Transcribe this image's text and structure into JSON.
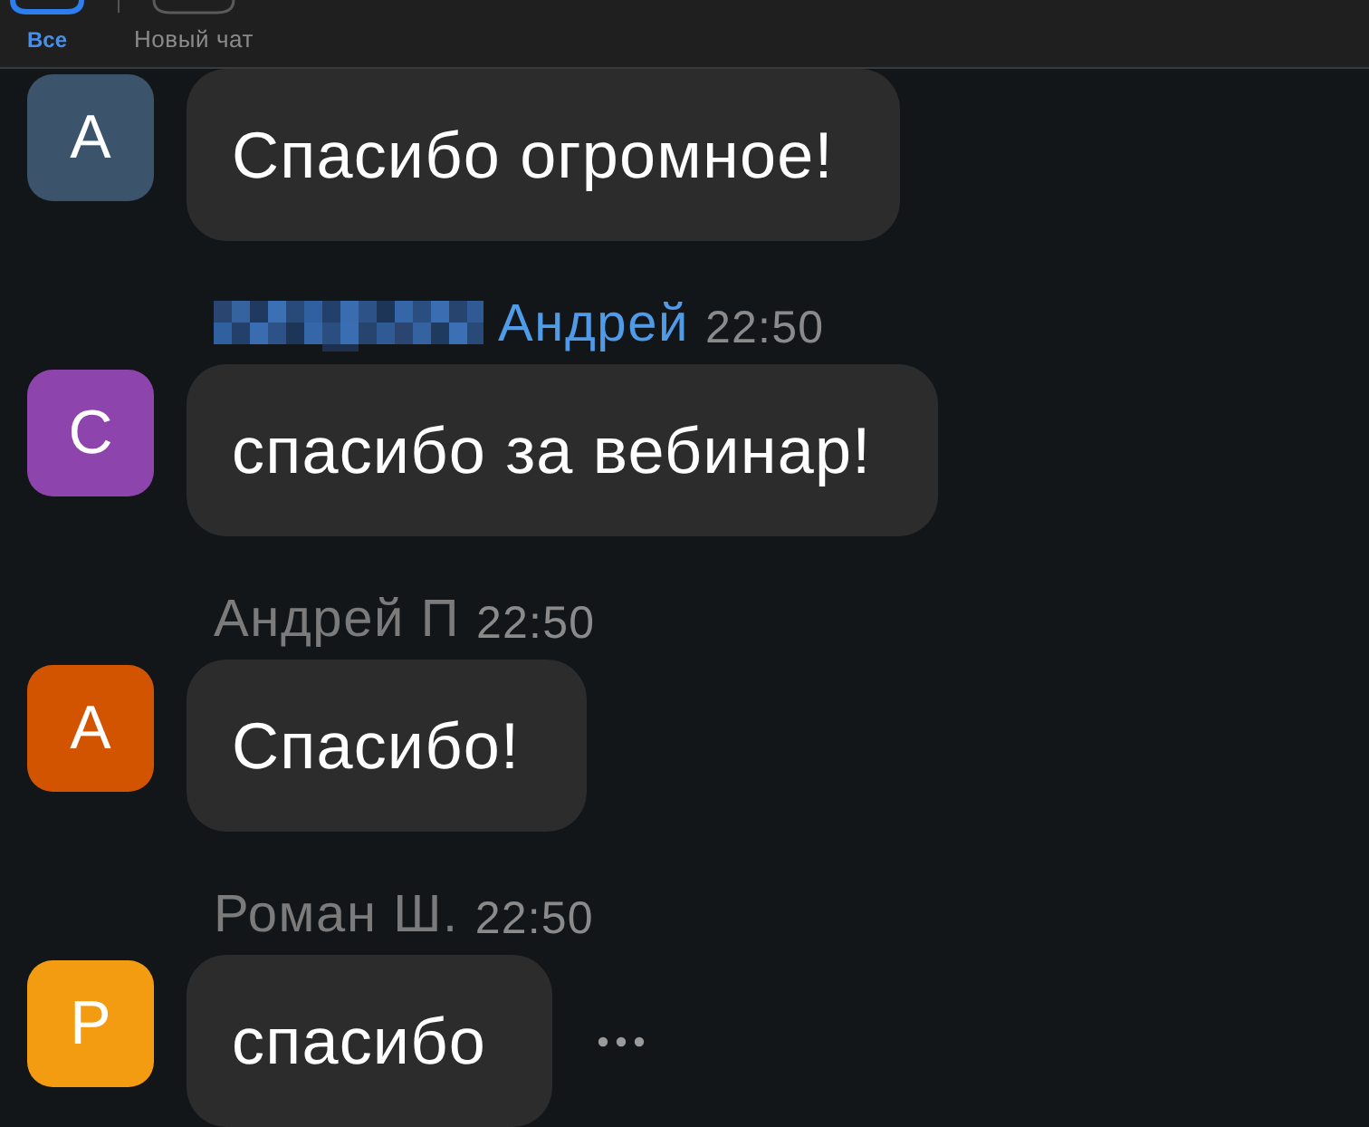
{
  "tabs": [
    {
      "label": "Все",
      "selected": true
    },
    {
      "label": "Новый чат",
      "selected": false
    }
  ],
  "messages": [
    {
      "avatar": {
        "letter": "А",
        "color": "#3b536b"
      },
      "text": "Спасибо огромное!",
      "hovered": false
    },
    {
      "header": {
        "redacted": true,
        "sender": "Андрей",
        "color": "#4f9be8",
        "time": "22:50"
      },
      "avatar": {
        "letter": "С",
        "color": "#8e44ad"
      },
      "text": "спасибо за вебинар!",
      "hovered": false
    },
    {
      "header": {
        "redacted": false,
        "sender": "Андрей П",
        "color": "#7b7b7b",
        "time": "22:50"
      },
      "avatar": {
        "letter": "А",
        "color": "#d35400"
      },
      "text": "Спасибо!",
      "hovered": false
    },
    {
      "header": {
        "redacted": false,
        "sender": "Роман Ш.",
        "color": "#7b7b7b",
        "time": "22:50"
      },
      "avatar": {
        "letter": "Р",
        "color": "#f39c12"
      },
      "text": "спасибо",
      "hovered": true
    }
  ]
}
